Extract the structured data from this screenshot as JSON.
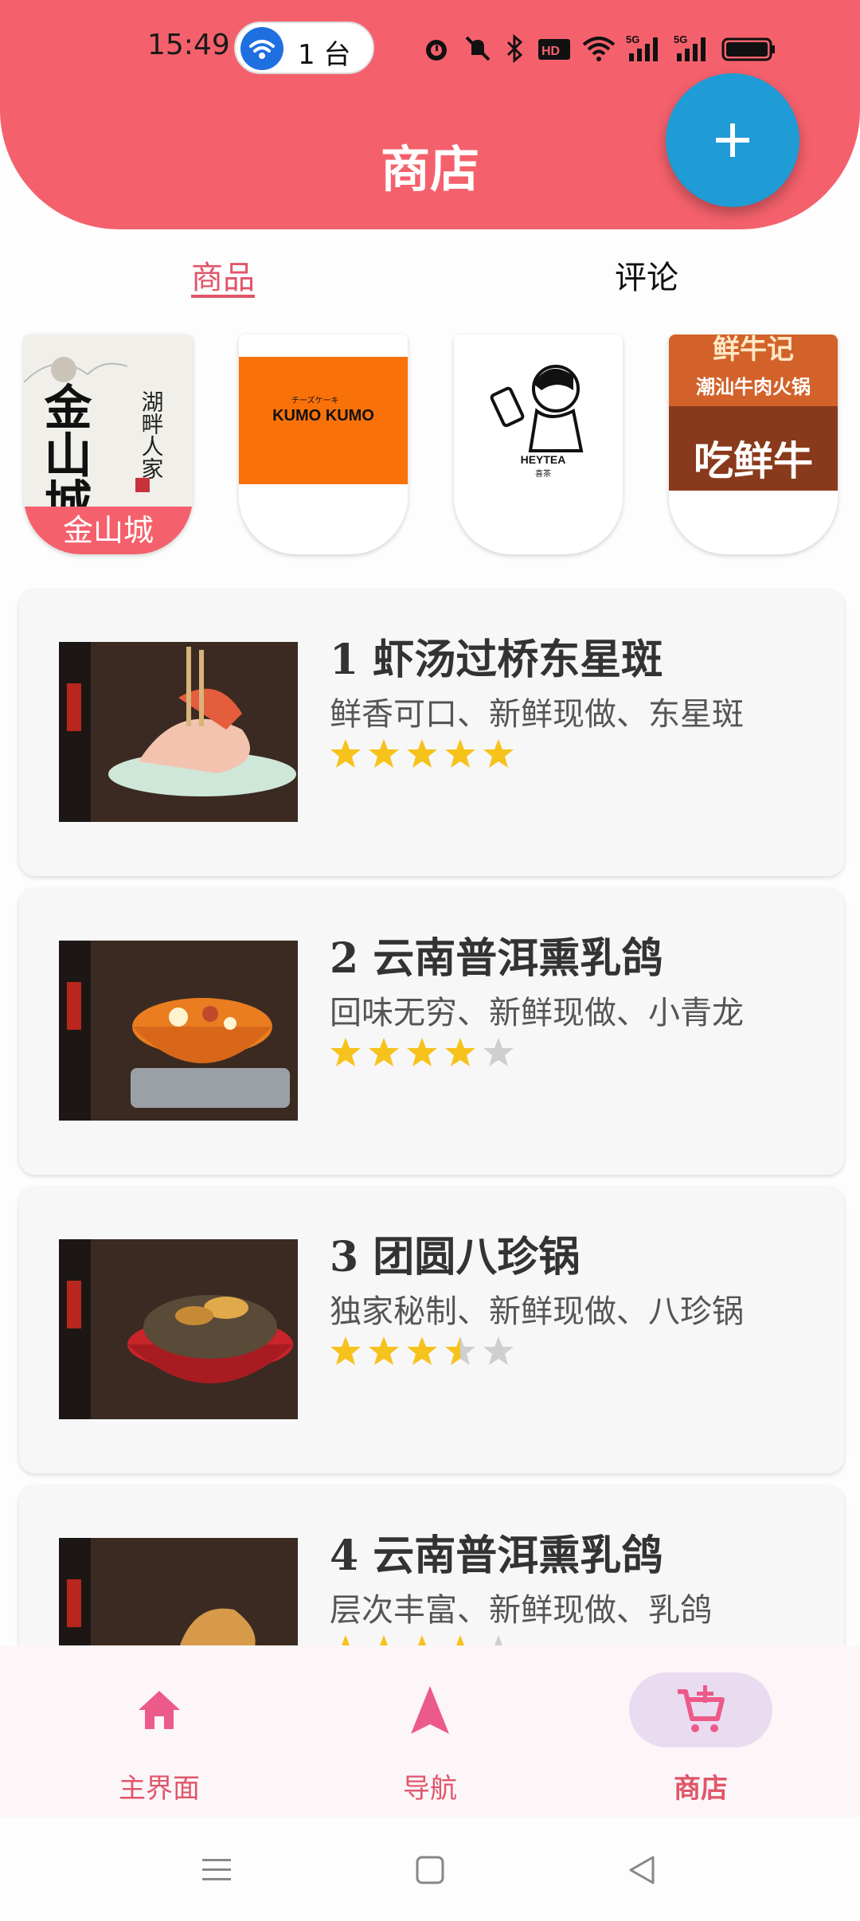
{
  "status_bar": {
    "time": "15:49",
    "hotspot_count": "1 台",
    "icons": [
      "alarm-icon",
      "mute-icon",
      "bluetooth-icon",
      "hd-icon",
      "wifi-icon",
      "signal-5g-icon",
      "signal-5g-icon",
      "battery-icon"
    ]
  },
  "header": {
    "title": "商店",
    "fab_icon": "plus-icon"
  },
  "tabs": [
    {
      "label": "商品",
      "selected": true
    },
    {
      "label": "评论",
      "selected": false
    }
  ],
  "stores": [
    {
      "name": "金山城",
      "logo_text": "金山城",
      "sub_text": "湖畔人家",
      "selected": true
    },
    {
      "name": "KUMO KUMO",
      "logo_text": "KUMO KUMO",
      "sub_text": "チーズケーキ",
      "selected": false
    },
    {
      "name": "HEYTEA",
      "logo_text": "HEYTEA",
      "sub_text": "喜茶",
      "selected": false
    },
    {
      "name": "鲜牛记",
      "logo_text": "鲜牛记",
      "sub_text": "潮汕牛肉火锅",
      "extra_text": "吃鲜牛",
      "selected": false
    }
  ],
  "products": [
    {
      "title": "1 虾汤过桥东星斑",
      "desc": "鲜香可口、新鲜现做、东星斑",
      "rating": 5
    },
    {
      "title": "2 云南普洱熏乳鸽",
      "desc": "回味无穷、新鲜现做、小青龙",
      "rating": 4
    },
    {
      "title": "3 团圆八珍锅",
      "desc": "独家秘制、新鲜现做、八珍锅",
      "rating": 3.5
    },
    {
      "title": "4 云南普洱熏乳鸽",
      "desc": "层次丰富、新鲜现做、乳鸽",
      "rating": 4
    }
  ],
  "bottom_nav": [
    {
      "label": "主界面",
      "icon": "home-icon",
      "active": false
    },
    {
      "label": "导航",
      "icon": "navigation-icon",
      "active": false
    },
    {
      "label": "商店",
      "icon": "cart-add-icon",
      "active": true
    }
  ],
  "colors": {
    "brand": "#f4616c",
    "fab": "#1f9bd5",
    "accent_text": "#e0566a",
    "star_filled": "#f6c21c",
    "star_empty": "#cfcfcf",
    "nav_active_pill": "#eadcf0"
  }
}
